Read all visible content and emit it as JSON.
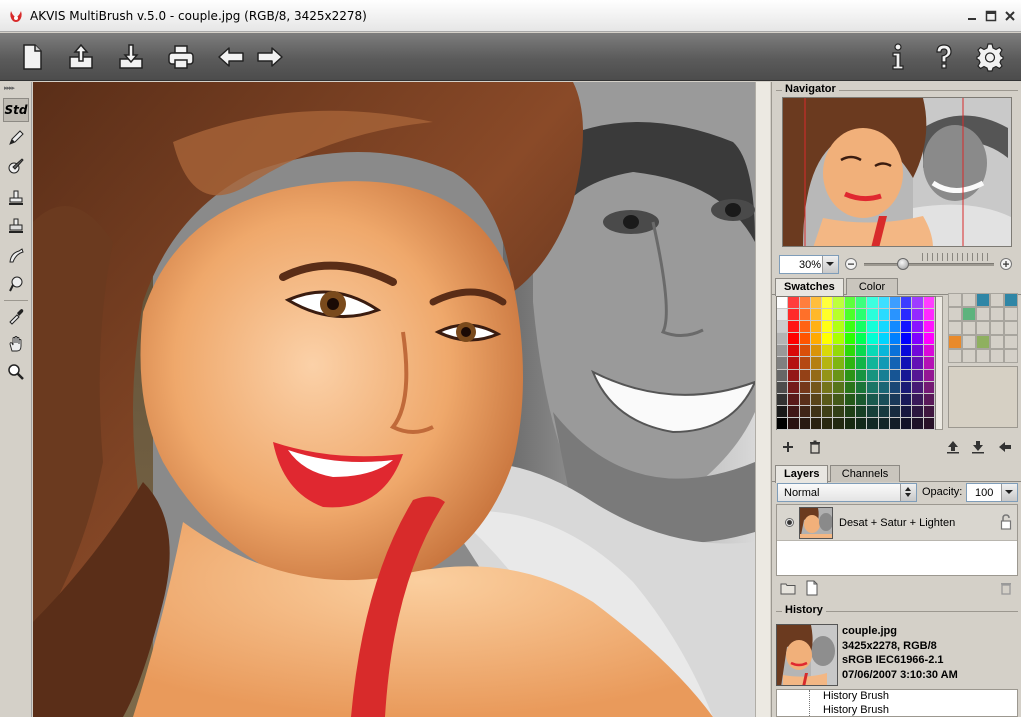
{
  "window": {
    "title": "AKVIS MultiBrush v.5.0 - couple.jpg (RGB/8, 3425x2278)"
  },
  "toolbar": {
    "left_icons": [
      "new-file-icon",
      "open-file-icon",
      "save-file-icon",
      "print-icon",
      "undo-arrow-icon",
      "redo-arrow-icon"
    ],
    "right_icons": [
      "info-icon",
      "help-icon",
      "settings-gear-icon"
    ]
  },
  "tools": {
    "std_label": "Std",
    "items": [
      "pencil-icon",
      "brush-icon",
      "stamp-icon",
      "stamp-alt-icon",
      "smudge-icon",
      "blur-icon",
      "eyedropper-icon",
      "hand-icon",
      "zoom-icon"
    ]
  },
  "navigator": {
    "title": "Navigator",
    "zoom": "30%"
  },
  "swatches": {
    "tab_swatches": "Swatches",
    "tab_color": "Color",
    "custom_colors": [
      "",
      "",
      "#2f86a6",
      "",
      "#2f86a6",
      "",
      "#5db37d",
      "",
      "",
      "",
      "",
      "",
      "",
      "",
      "",
      "#e98a2b",
      "",
      "#8fb060",
      "",
      "",
      "",
      "",
      "",
      "",
      ""
    ],
    "preview_color": "#d6d0c4"
  },
  "layers": {
    "tab_layers": "Layers",
    "tab_channels": "Channels",
    "blend_mode": "Normal",
    "opacity_label": "Opacity:",
    "opacity_value": "100",
    "layer_name": "Desat + Satur + Lighten"
  },
  "history": {
    "title": "History",
    "filename": "couple.jpg",
    "info_line1": "3425x2278, RGB/8",
    "info_line2": "sRGB IEC61966-2.1",
    "info_line3": "07/06/2007 3:10:30 AM",
    "items": [
      "History Brush",
      "History Brush"
    ]
  },
  "colors": {
    "accent_red": "#d82b2b",
    "panel_bg": "#d4d0c8"
  }
}
